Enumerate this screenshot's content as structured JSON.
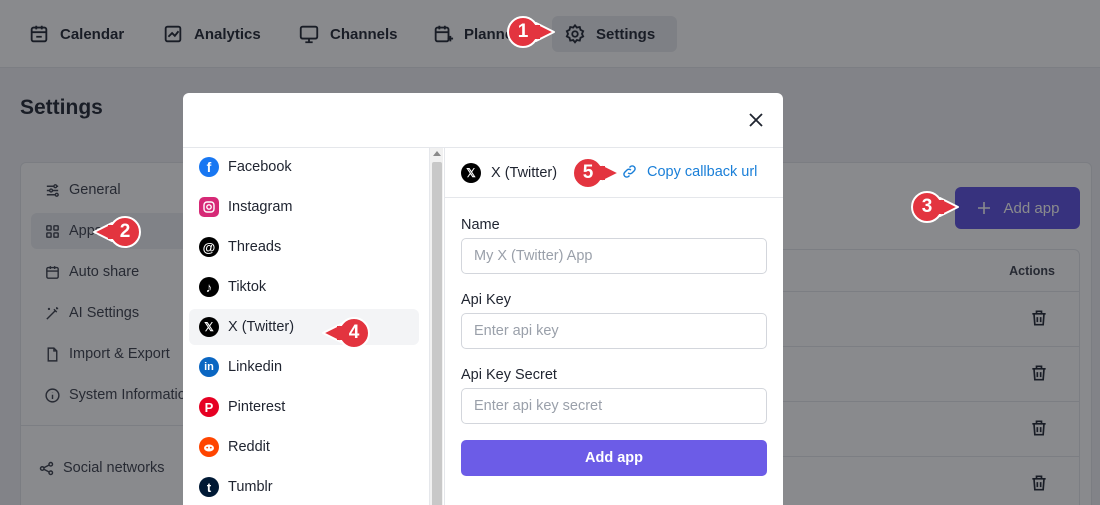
{
  "topnav": {
    "items": [
      {
        "label": "Calendar",
        "icon": "calendar-icon"
      },
      {
        "label": "Analytics",
        "icon": "analytics-chart-icon"
      },
      {
        "label": "Channels",
        "icon": "monitor-icon"
      },
      {
        "label": "Planne",
        "icon": "calendar-plus-icon"
      },
      {
        "label": "Settings",
        "icon": "gear-icon",
        "active": true
      }
    ]
  },
  "page": {
    "title": "Settings"
  },
  "sidebar": {
    "items": [
      {
        "label": "General",
        "icon": "sliders-icon"
      },
      {
        "label": "Apps",
        "icon": "apps-grid-icon",
        "active": true
      },
      {
        "label": "Auto share",
        "icon": "calendar-icon"
      },
      {
        "label": "AI Settings",
        "icon": "magic-wand-icon"
      },
      {
        "label": "Import & Export",
        "icon": "file-icon"
      },
      {
        "label": "System Informatio",
        "icon": "info-icon"
      },
      {
        "label": "Social networks",
        "icon": "share-nodes-icon"
      }
    ]
  },
  "apps_table": {
    "add_app_label": "Add app",
    "actions_header": "Actions"
  },
  "modal": {
    "providers": [
      {
        "label": "Facebook",
        "icon": "facebook-icon",
        "color": "#1877f2"
      },
      {
        "label": "Instagram",
        "icon": "instagram-icon",
        "color": "#d62976"
      },
      {
        "label": "Threads",
        "icon": "threads-icon",
        "color": "#000000"
      },
      {
        "label": "Tiktok",
        "icon": "tiktok-icon",
        "color": "#000000"
      },
      {
        "label": "X (Twitter)",
        "icon": "x-twitter-icon",
        "color": "#000000",
        "active": true
      },
      {
        "label": "Linkedin",
        "icon": "linkedin-icon",
        "color": "#0a66c2"
      },
      {
        "label": "Pinterest",
        "icon": "pinterest-icon",
        "color": "#e60023"
      },
      {
        "label": "Reddit",
        "icon": "reddit-icon",
        "color": "#ff4500"
      },
      {
        "label": "Tumblr",
        "icon": "tumblr-icon",
        "color": "#001935"
      }
    ],
    "selected_title": "X (Twitter)",
    "copy_callback_label": "Copy callback url",
    "form": {
      "name_label": "Name",
      "name_placeholder": "My X (Twitter) App",
      "api_key_label": "Api Key",
      "api_key_placeholder": "Enter api key",
      "api_secret_label": "Api Key Secret",
      "api_secret_placeholder": "Enter api key secret",
      "submit_label": "Add app"
    }
  },
  "callouts": [
    "1",
    "2",
    "3",
    "4",
    "5"
  ],
  "colors": {
    "accent": "#5b4fe0",
    "button": "#6c5ce7",
    "link": "#1a7fd8",
    "callout": "#e3343f"
  }
}
